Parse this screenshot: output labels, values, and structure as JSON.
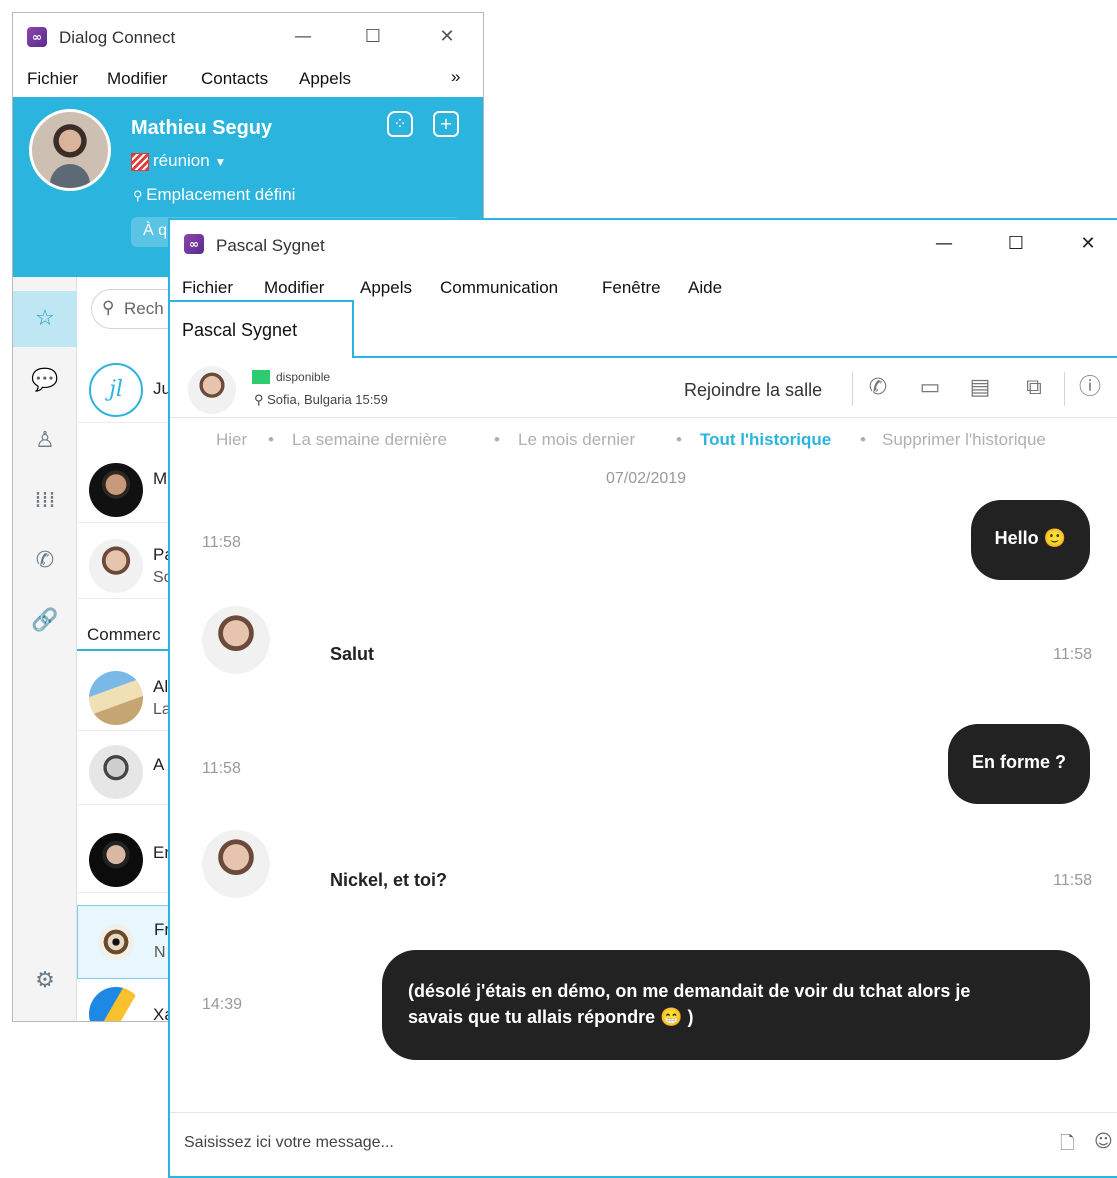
{
  "back_window": {
    "title": "Dialog Connect",
    "logo": "infinity-logo-icon",
    "menu": [
      "Fichier",
      "Modifier",
      "Contacts",
      "Appels"
    ],
    "menu_overflow": "»",
    "profile": {
      "name": "Mathieu Seguy",
      "status": "réunion",
      "location": "Emplacement défini",
      "note_placeholder": "À q"
    },
    "search_placeholder": "Rech",
    "contacts": [
      {
        "initials": "jl",
        "name": "Ju",
        "sub": ""
      },
      {
        "name": "M",
        "sub": ""
      },
      {
        "name": "Pa",
        "sub": "So"
      },
      {
        "name": "Al",
        "sub": "La"
      },
      {
        "name": "A",
        "sub": ""
      },
      {
        "name": "Er",
        "sub": ""
      },
      {
        "name": "Fr",
        "sub": "N"
      },
      {
        "name": "Xa",
        "sub": ""
      }
    ],
    "group_label": "Commerc"
  },
  "front_window": {
    "title": "Pascal Sygnet",
    "menu": [
      "Fichier",
      "Modifier",
      "Appels",
      "Communication",
      "Fenêtre",
      "Aide"
    ],
    "tab_label": "Pascal Sygnet",
    "contact": {
      "status": "disponible",
      "location": "Sofia, Bulgaria 15:59",
      "status_color": "#2ecc71"
    },
    "join_room": "Rejoindre la salle",
    "filters": [
      "Hier",
      "La semaine dernière",
      "Le mois dernier",
      "Tout l'historique",
      "Supprimer l'historique"
    ],
    "active_filter": "Tout l'historique",
    "date": "07/02/2019",
    "messages": [
      {
        "direction": "out",
        "time": "11:58",
        "text": "Hello 🙂"
      },
      {
        "direction": "in",
        "time": "11:58",
        "text": "Salut"
      },
      {
        "direction": "out",
        "time": "11:58",
        "text": "En forme ?"
      },
      {
        "direction": "in",
        "time": "11:58",
        "text": "Nickel, et toi?"
      },
      {
        "direction": "out",
        "time": "14:39",
        "text_line1": "(désolé j'étais en démo, on me demandait de voir du tchat alors je",
        "text_line2": "savais que tu allais répondre 😁 )"
      }
    ],
    "composer_placeholder": "Saisissez ici votre message..."
  },
  "colors": {
    "accent": "#2bb4dd",
    "bubble": "#222222",
    "available": "#2ecc71",
    "busy": "#e53935"
  }
}
